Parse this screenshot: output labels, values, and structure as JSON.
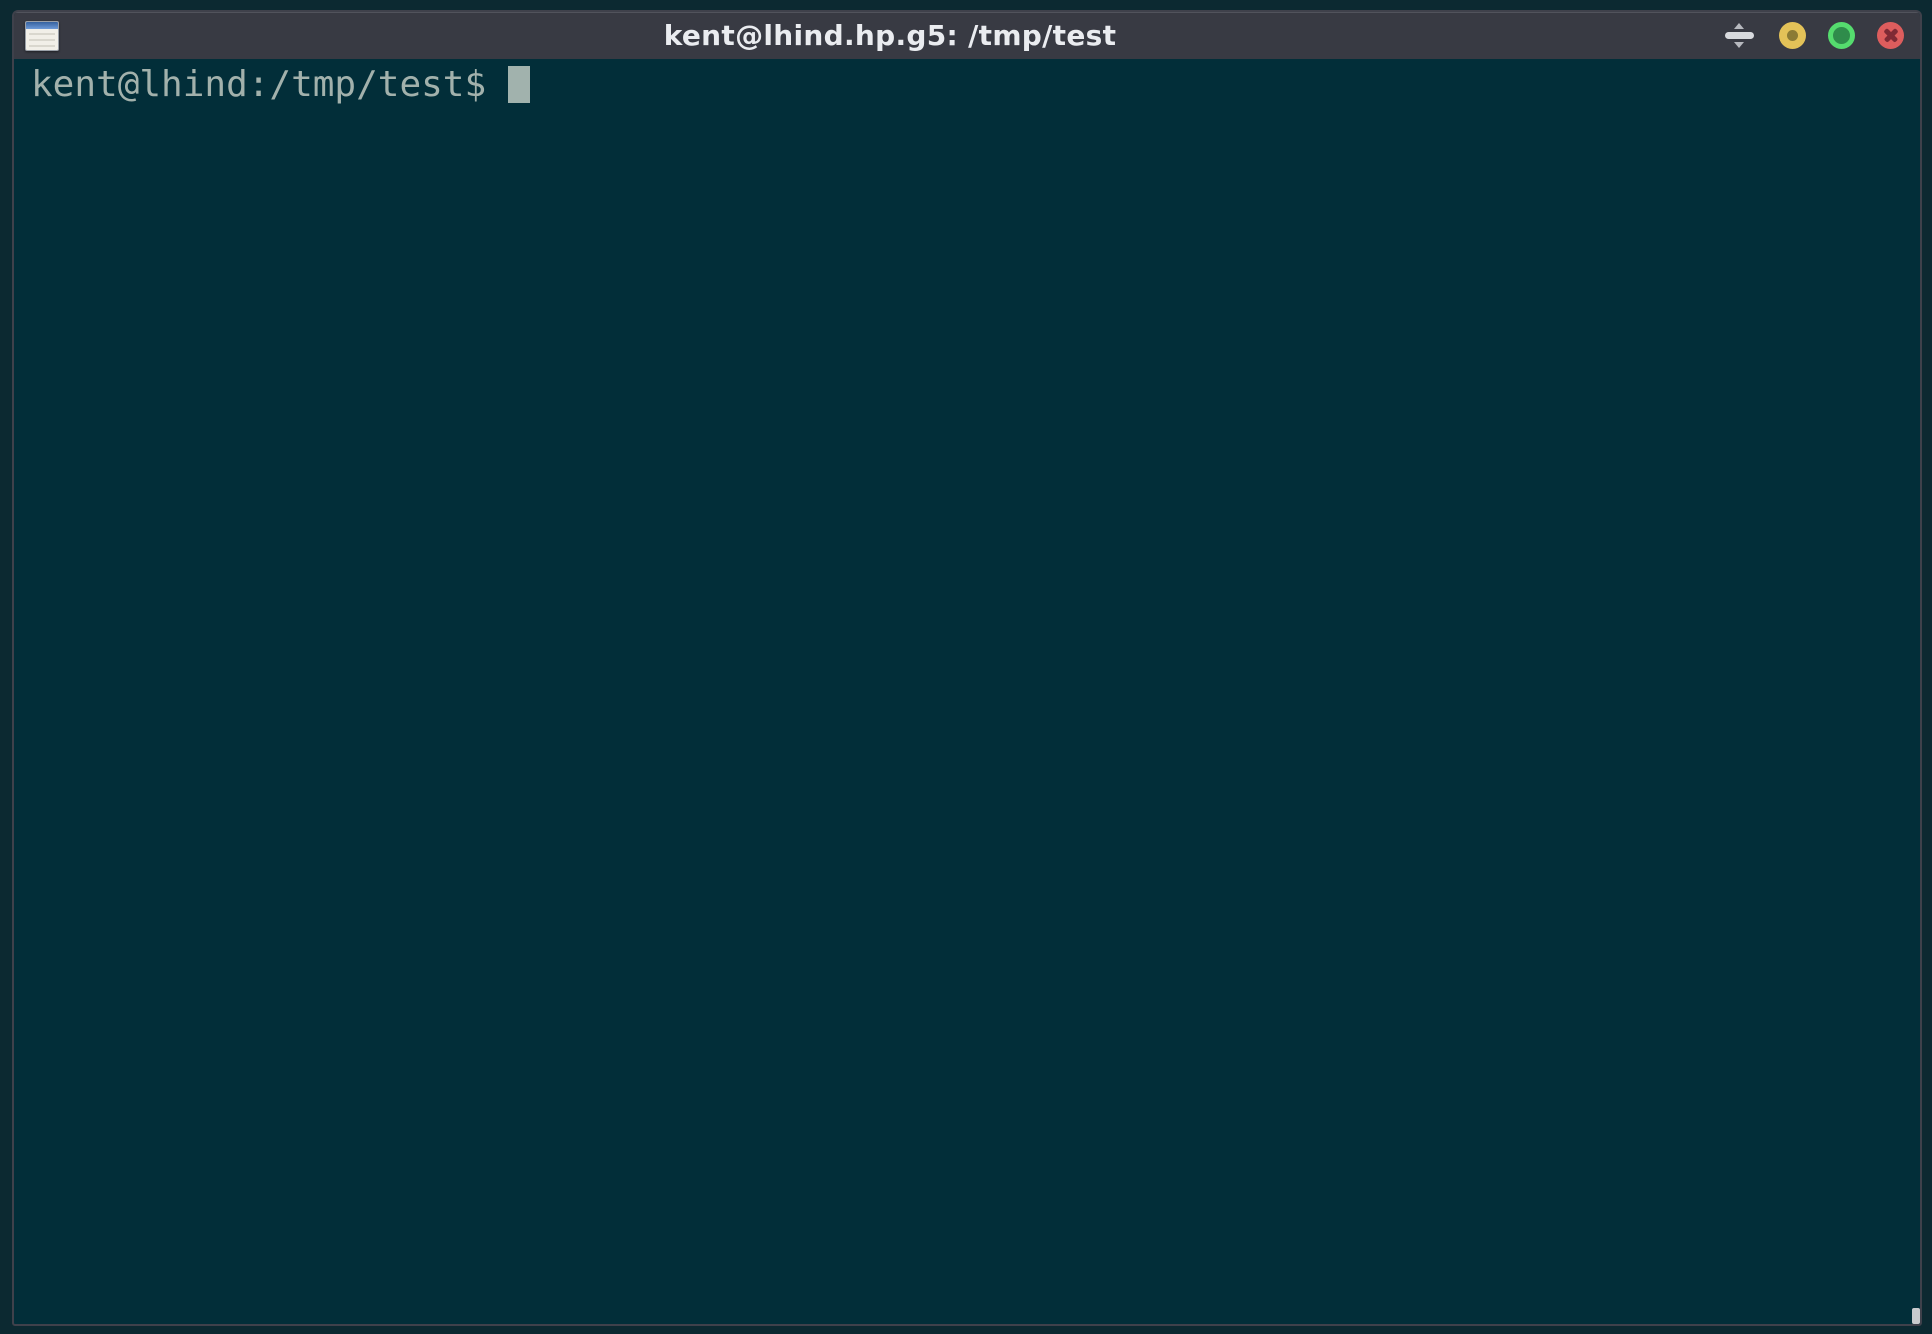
{
  "window": {
    "title": "kent@lhind.hp.g5: /tmp/test",
    "controls": {
      "shade_icon": "shade-rollup-icon",
      "minimize_icon": "yellow-dot-circle",
      "maximize_icon": "green-ring-circle",
      "close_icon": "red-x-circle"
    },
    "app_icon": "terminal-window-icon",
    "colors": {
      "titlebar_bg": "#383a43",
      "titlebar_highlight": "#51535c",
      "title_text": "#eaecf0",
      "window_border": "#3f414b",
      "minimize_yellow": "#e3c258",
      "maximize_green": "#55dc6e",
      "maximize_green_fill": "#2f8c4b",
      "close_red": "#dd5d5d",
      "close_x": "#7e2a35"
    }
  },
  "terminal": {
    "prompt": "kent@lhind:/tmp/test$",
    "cursor_style": "block",
    "colors": {
      "background": "#022e39",
      "foreground": "#a2b1ac",
      "cursor": "#a1b2ad"
    }
  },
  "desktop": {
    "background": "#0c2931"
  }
}
